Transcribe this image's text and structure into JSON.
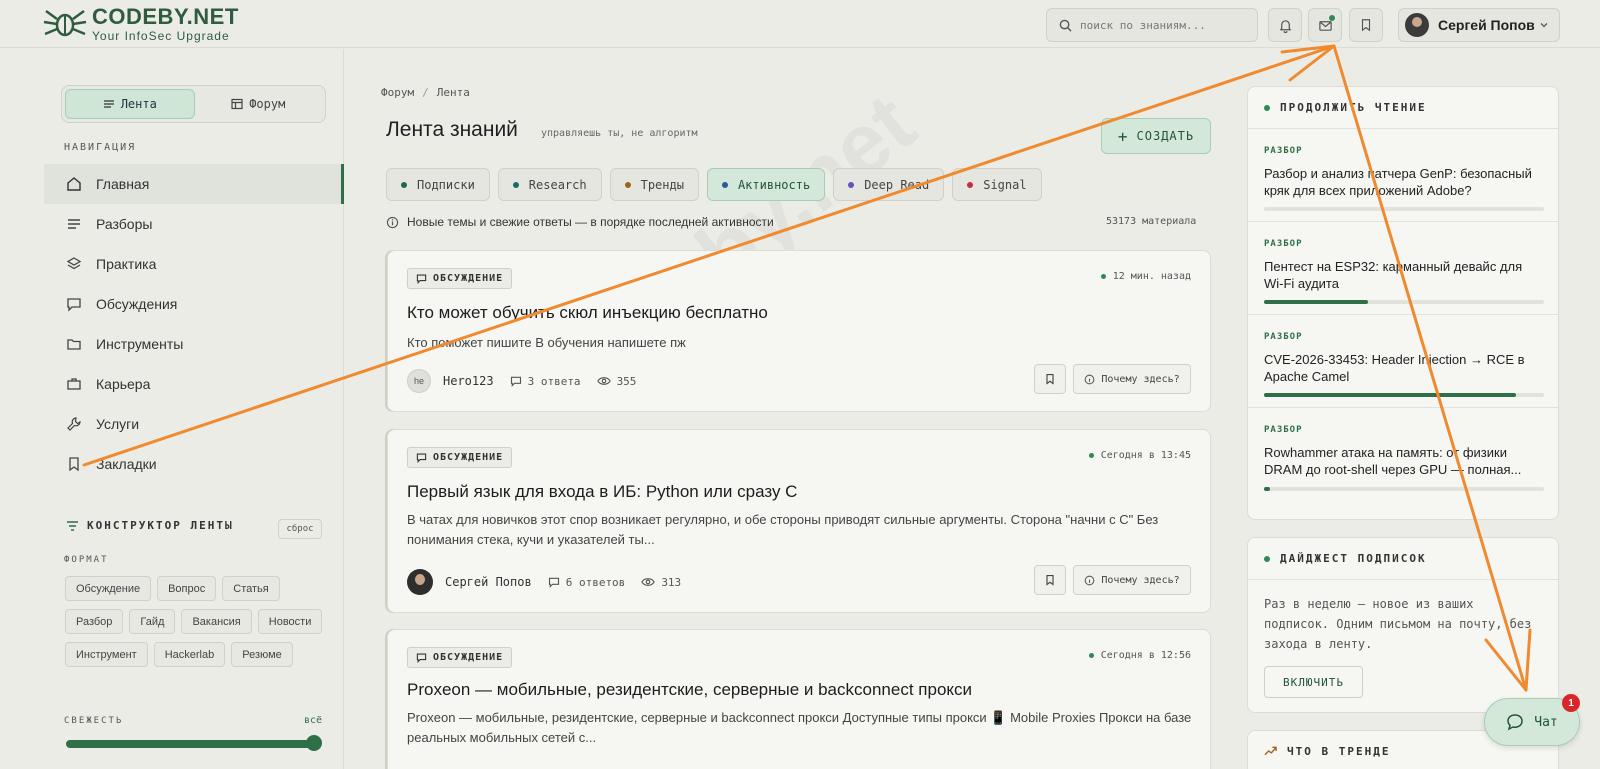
{
  "brand": {
    "name": "CODEBY.NET",
    "tagline": "Your InfoSec Upgrade"
  },
  "header": {
    "search_placeholder": "поиск по знаниям...",
    "user_name": "Сергей Попов"
  },
  "sidebar": {
    "toggle": {
      "feed": "Лента",
      "forum": "Форум"
    },
    "nav_label": "НАВИГАЦИЯ",
    "nav": [
      {
        "label": "Главная",
        "icon": "home-icon"
      },
      {
        "label": "Разборы",
        "icon": "list-icon"
      },
      {
        "label": "Практика",
        "icon": "layers-icon"
      },
      {
        "label": "Обсуждения",
        "icon": "chat-icon"
      },
      {
        "label": "Инструменты",
        "icon": "folder-icon"
      },
      {
        "label": "Карьера",
        "icon": "briefcase-icon"
      },
      {
        "label": "Услуги",
        "icon": "wrench-icon"
      },
      {
        "label": "Закладки",
        "icon": "bookmark-icon"
      }
    ],
    "constructor": {
      "title": "КОНСТРУКТОР ЛЕНТЫ",
      "reset": "сброс",
      "format_label": "ФОРМАТ",
      "formats": [
        "Обсуждение",
        "Вопрос",
        "Статья",
        "Разбор",
        "Гайд",
        "Вакансия",
        "Новости",
        "Инструмент",
        "Hackerlab",
        "Резюме"
      ],
      "freshness_label": "СВЕЖЕСТЬ",
      "freshness_value": "всё",
      "freshness_level": 1.0
    }
  },
  "main": {
    "breadcrumb": [
      "Форум",
      "Лента"
    ],
    "title": "Лента знаний",
    "subtitle": "управляешь ты, не алгоритм",
    "create_label": "СОЗДАТЬ",
    "tabs": [
      {
        "label": "Подписки",
        "color": "#1f6b45"
      },
      {
        "label": "Research",
        "color": "#1a6b6b"
      },
      {
        "label": "Тренды",
        "color": "#a0641f"
      },
      {
        "label": "Активность",
        "color": "#2a5a9a"
      },
      {
        "label": "Deep Read",
        "color": "#6a4fbf"
      },
      {
        "label": "Signal",
        "color": "#c03040"
      }
    ],
    "info_text": "Новые темы и свежие ответы — в порядке последней активности",
    "count_text": "53173 материала",
    "posts": [
      {
        "badge": "ОБСУЖДЕНИЕ",
        "time": "12 мин. назад",
        "title": "Кто может обучить скюл инъекцию бесплатно",
        "text": "Кто поможет пишите В обучения напишете пж",
        "author": "Hero123",
        "author_initials": "he",
        "replies": "3 ответа",
        "views": "355",
        "why": "Почему здесь?"
      },
      {
        "badge": "ОБСУЖДЕНИЕ",
        "time": "Сегодня в 13:45",
        "title": "Первый язык для входа в ИБ: Python или сразу C",
        "text": "В чатах для новичков этот спор возникает регулярно, и обе стороны приводят сильные аргументы. Сторона \"начни с С\" Без понимания стека, кучи и указателей ты...",
        "author": "Сергей Попов",
        "replies": "6 ответов",
        "views": "313",
        "why": "Почему здесь?"
      },
      {
        "badge": "ОБСУЖДЕНИЕ",
        "time": "Сегодня в 12:56",
        "title": "Proxeon — мобильные, резидентские, серверные и backconnect прокси",
        "text": "Proxeon — мобильные, резидентские, серверные и backconnect прокси Доступные типы прокси 📱 Mobile Proxies Прокси на базе реальных мобильных сетей с..."
      }
    ]
  },
  "right": {
    "continue_title": "ПРОДОЛЖИТЬ ЧТЕНИЕ",
    "reading": [
      {
        "tag": "РАЗБОР",
        "title": "Разбор и анализ патчера GenP: безопасный кряк для всех приложений Adobe?",
        "progress": 0.0
      },
      {
        "tag": "РАЗБОР",
        "title": "Пентест на ESP32: карманный девайс для Wi-Fi аудита",
        "progress": 0.37
      },
      {
        "tag": "РАЗБОР",
        "title": "CVE-2026-33453: Header Injection → RCE в Apache Camel",
        "progress": 0.9
      },
      {
        "tag": "РАЗБОР",
        "title": "Rowhammer атака на память: от физики DRAM до root-shell через GPU — полная...",
        "progress": 0.02
      }
    ],
    "digest_title": "ДАЙДЖЕСТ ПОДПИСОК",
    "digest_text": "Раз в неделю — новое из ваших подписок. Одним письмом на почту, без захода в ленту.",
    "digest_button": "ВКЛЮЧИТЬ",
    "trend_title": "ЧТО В ТРЕНДЕ"
  },
  "chat": {
    "label": "Чат",
    "badge": "1"
  },
  "watermark": "codeby.net",
  "colors": {
    "accent": "#2f6f48",
    "annotation": "#f08a2e",
    "notify": "#d9262b"
  }
}
